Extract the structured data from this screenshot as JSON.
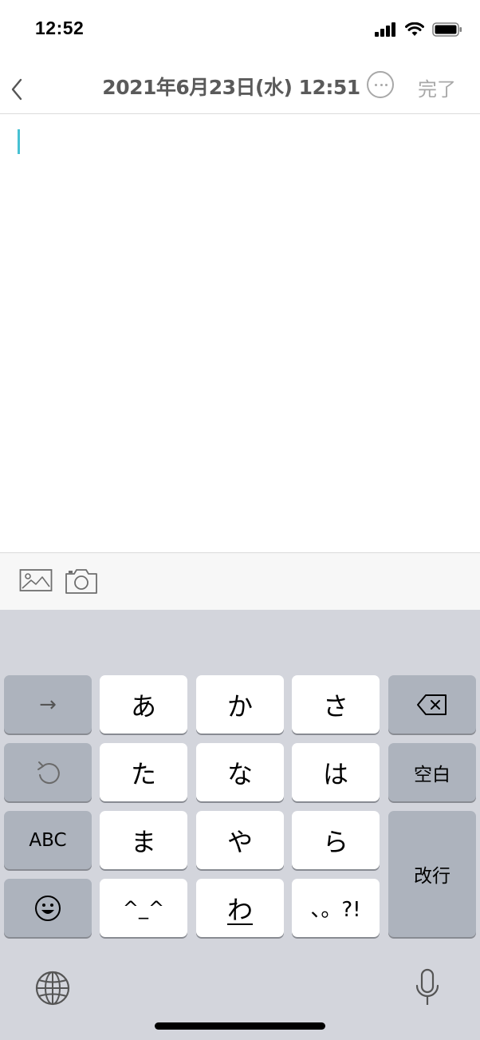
{
  "status_bar": {
    "time": "12:52"
  },
  "nav": {
    "title": "2021年6月23日(水) 12:51",
    "done": "完了"
  },
  "keyboard": {
    "rows": [
      [
        "→",
        "あ",
        "か",
        "さ"
      ],
      [
        "た",
        "な",
        "は",
        "空白"
      ],
      [
        "ABC",
        "ま",
        "や",
        "ら",
        "改行"
      ],
      [
        "^_^",
        "わ",
        "、。?!"
      ]
    ],
    "arrow": "→",
    "kana": {
      "a": "あ",
      "ka": "か",
      "sa": "さ",
      "ta": "た",
      "na": "な",
      "ha": "は",
      "ma": "ま",
      "ya": "や",
      "ra": "ら",
      "emoticon": "^_^",
      "wa": "わ",
      "punct": "、。?!"
    },
    "space": "空白",
    "abc": "ABC",
    "enter": "改行"
  },
  "icons": {
    "back": "chevron-left-icon",
    "more": "more-icon",
    "image": "image-icon",
    "camera": "camera-icon",
    "delete": "delete-icon",
    "undo": "undo-icon",
    "emoji": "emoji-icon",
    "globe": "globe-icon",
    "mic": "mic-icon"
  },
  "colors": {
    "caret": "#47c1d3",
    "keyboard_bg": "#d3d5dc",
    "dark_key": "#adb3bd"
  }
}
